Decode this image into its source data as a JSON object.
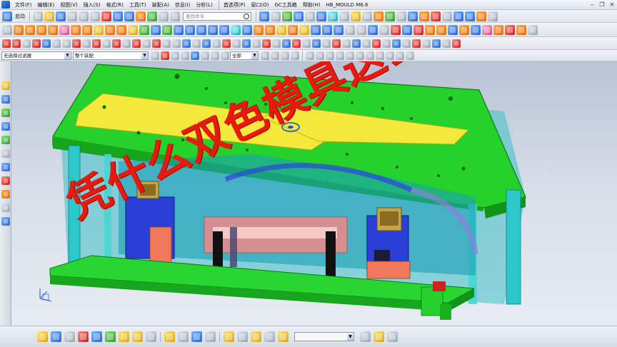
{
  "menubar": {
    "items": [
      "文件(F)",
      "编辑(E)",
      "视图(V)",
      "插入(S)",
      "格式(R)",
      "工具(T)",
      "装配(A)",
      "信息(I)",
      "分析(L)",
      "首选项(P)",
      "窗口(O)",
      "GC工具箱",
      "帮助(H)",
      "HB_MOULD M6.6"
    ]
  },
  "toolbar1": {
    "start_label": "启动",
    "search_placeholder": "查找命令"
  },
  "selection_bar": {
    "filter_label": "无选择过滤器",
    "scope_label": "整个装配",
    "type_label": "全部"
  },
  "overlay": {
    "caption": "凭什么双色模具这么屌?"
  },
  "colors": {
    "plate_green": "#22d22a",
    "cavity_yellow": "#f2e83a",
    "cyan": "#16c9d6",
    "blue": "#2c4cd8",
    "caption_red": "#e81a10"
  }
}
